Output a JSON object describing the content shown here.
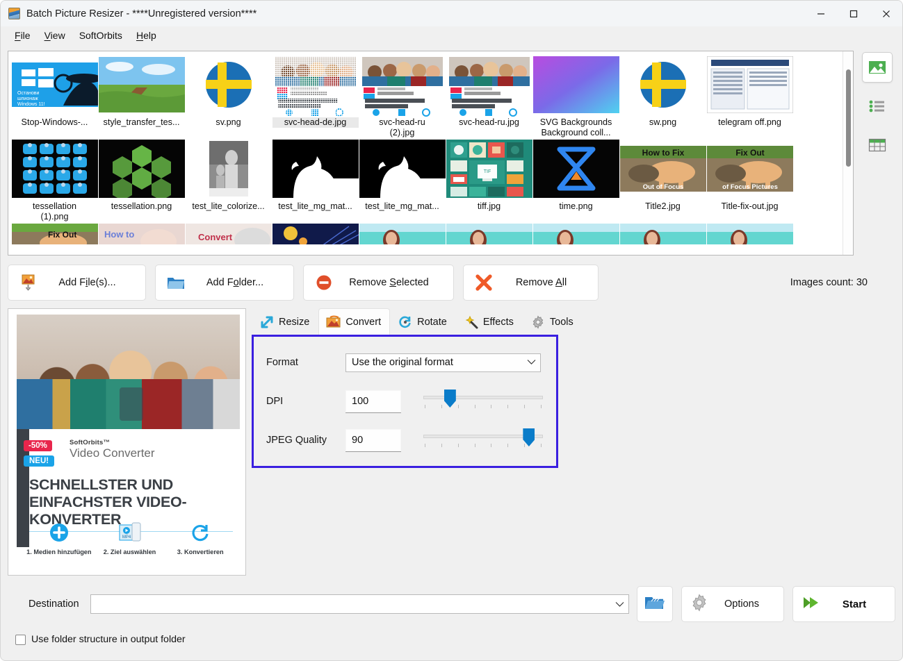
{
  "window": {
    "title": "Batch Picture Resizer - ****Unregistered version****",
    "app_icon": "picture-resizer-icon",
    "controls": {
      "minimize": "minimize-icon",
      "maximize": "maximize-icon",
      "close": "close-icon"
    }
  },
  "menubar": {
    "items": [
      {
        "label": "File",
        "accel": "F"
      },
      {
        "label": "View",
        "accel": "V"
      },
      {
        "label": "SoftOrbits",
        "accel": ""
      },
      {
        "label": "Help",
        "accel": "H"
      }
    ]
  },
  "filelist": {
    "view_modes": [
      {
        "name": "thumbnails-view-icon",
        "active": true
      },
      {
        "name": "list-view-icon",
        "active": false
      },
      {
        "name": "details-view-icon",
        "active": false
      }
    ],
    "thumbnails": [
      {
        "label": "Stop-Windows-...",
        "selected": false,
        "art": "stop-windows"
      },
      {
        "label": "style_transfer_tes...",
        "selected": false,
        "art": "landscape"
      },
      {
        "label": "sv.png",
        "selected": false,
        "art": "sweden-flag-circle"
      },
      {
        "label": "svc-head-de.jpg",
        "selected": true,
        "art": "video-converter-de"
      },
      {
        "label": "svc-head-ru",
        "label2": "(2).jpg",
        "selected": false,
        "art": "video-converter-ru"
      },
      {
        "label": "svc-head-ru.jpg",
        "selected": false,
        "art": "video-converter-ru"
      },
      {
        "label": "SVG Backgrounds",
        "label2": "Background coll...",
        "selected": false,
        "art": "gradient-purple"
      },
      {
        "label": "sw.png",
        "selected": false,
        "art": "sweden-flag-circle"
      },
      {
        "label": "telegram off.png",
        "selected": false,
        "art": "screenshot-doc"
      },
      {
        "label": "tessellation",
        "label2": "(1).png",
        "selected": false,
        "art": "tessellation-blue"
      },
      {
        "label": "tessellation.png",
        "selected": false,
        "art": "tessellation-green"
      },
      {
        "label": "test_lite_colorize...",
        "selected": false,
        "art": "bw-photo"
      },
      {
        "label": "test_lite_mg_mat...",
        "selected": false,
        "art": "matte-mask"
      },
      {
        "label": "test_lite_mg_mat...",
        "selected": false,
        "art": "matte-mask"
      },
      {
        "label": "tiff.jpg",
        "selected": false,
        "art": "tiff-tiles"
      },
      {
        "label": "time.png",
        "selected": false,
        "art": "time-logo"
      },
      {
        "label": "Title2.jpg",
        "selected": false,
        "art": "cat-how-to-fix"
      },
      {
        "label": "Title-fix-out.jpg",
        "selected": false,
        "art": "cat-fix-out"
      }
    ],
    "thumbnails_row3": [
      {
        "art": "cat-fix-out-crop"
      },
      {
        "art": "how-to-crop"
      },
      {
        "art": "convert-crop"
      },
      {
        "art": "space-crop"
      },
      {
        "art": "beach-woman"
      },
      {
        "art": "beach-woman"
      },
      {
        "art": "beach-woman"
      },
      {
        "art": "beach-woman"
      },
      {
        "art": "beach-woman"
      }
    ],
    "scrollbar": {
      "name": "vertical-scrollbar"
    }
  },
  "actions": {
    "add_files": {
      "label": "Add File(s)...",
      "accel": "i",
      "icon": "add-image-icon"
    },
    "add_folder": {
      "label": "Add Folder...",
      "accel": "o",
      "icon": "folder-icon"
    },
    "remove_selected": {
      "label": "Remove Selected",
      "accel": "S",
      "icon": "no-entry-icon"
    },
    "remove_all": {
      "label": "Remove All",
      "accel": "A",
      "icon": "red-x-icon"
    },
    "images_count": "Images count: 30"
  },
  "tabs": [
    {
      "label": "Resize",
      "icon": "resize-arrows-icon",
      "active": false
    },
    {
      "label": "Convert",
      "icon": "convert-image-icon",
      "active": true
    },
    {
      "label": "Rotate",
      "icon": "rotate-icon",
      "active": false
    },
    {
      "label": "Effects",
      "icon": "magic-wand-icon",
      "active": false
    },
    {
      "label": "Tools",
      "icon": "gear-icon",
      "active": false
    }
  ],
  "convert_panel": {
    "highlight_color": "#3a1fe0",
    "format": {
      "label": "Format",
      "value": "Use the original format",
      "options": [
        "Use the original format"
      ]
    },
    "dpi": {
      "label": "DPI",
      "value": "100",
      "slider_percent": 22
    },
    "jpeg_quality": {
      "label": "JPEG Quality",
      "value": "90",
      "slider_percent": 88
    }
  },
  "preview": {
    "name": "selected-image-preview",
    "ad": {
      "discount": "-50%",
      "new_badge": "NEU!",
      "brand": "SoftOrbits™",
      "product": "Video Converter",
      "headline": "SCHNELLSTER UND EINFACHSTER VIDEO-KONVERTER",
      "steps": [
        {
          "label": "1. Medien hinzufügen",
          "icon": "plus-circle-icon"
        },
        {
          "label": "2. Ziel auswählen",
          "icon": "mp4-phone-icon"
        },
        {
          "label": "3. Konvertieren",
          "icon": "refresh-icon"
        }
      ]
    }
  },
  "destination": {
    "label": "Destination",
    "value": "",
    "placeholder": "",
    "browse_icon": "open-folder-icon"
  },
  "buttons": {
    "options": {
      "label": "Options",
      "icon": "gear-icon"
    },
    "start": {
      "label": "Start",
      "icon": "green-arrows-icon"
    }
  },
  "checkbox": {
    "label": "Use folder structure in output folder",
    "checked": false
  }
}
